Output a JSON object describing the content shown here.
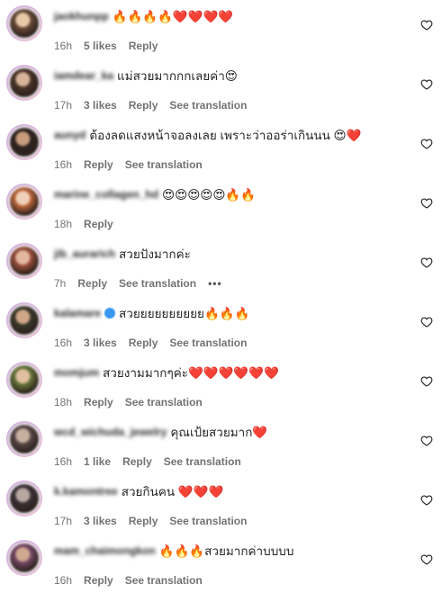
{
  "comments": [
    {
      "username": "jaokhunpp",
      "text": "🔥🔥🔥🔥❤️❤️❤️❤️",
      "time": "16h",
      "likes": "5 likes",
      "reply": "Reply",
      "see_translation": "",
      "verified": false
    },
    {
      "username": "iamdear_ka",
      "text": "แม่สวยมากกกเลยค่า😍",
      "time": "17h",
      "likes": "3 likes",
      "reply": "Reply",
      "see_translation": "See translation",
      "verified": false
    },
    {
      "username": "aunyd",
      "text": "ต้องลดแสงหน้าจอลงเลย เพราะว่าออร่าเกินนน 😍❤️",
      "time": "16h",
      "likes": "",
      "reply": "Reply",
      "see_translation": "See translation",
      "verified": false
    },
    {
      "username": "marine_collagen_hd",
      "text": "😍😍😍😍😍🔥🔥",
      "time": "18h",
      "likes": "",
      "reply": "Reply",
      "see_translation": "",
      "verified": false
    },
    {
      "username": "jib_aurarich",
      "text": "สวยปังมากค่ะ",
      "time": "7h",
      "likes": "",
      "reply": "Reply",
      "see_translation": "See translation",
      "more": "•••",
      "verified": false
    },
    {
      "username": "kalamare",
      "text": "สวยยยยยยยยยย🔥🔥🔥",
      "time": "16h",
      "likes": "3 likes",
      "reply": "Reply",
      "see_translation": "See translation",
      "verified": true
    },
    {
      "username": "momjum",
      "text": "สวยงามมากๆค่ะ❤️❤️❤️❤️❤️❤️",
      "time": "18h",
      "likes": "",
      "reply": "Reply",
      "see_translation": "See translation",
      "verified": false
    },
    {
      "username": "wcd_wichuda_jewelry",
      "text": "คุณเป้ยสวยมาก❤️",
      "time": "16h",
      "likes": "1 like",
      "reply": "Reply",
      "see_translation": "See translation",
      "verified": false
    },
    {
      "username": "k.kamontree",
      "text": "สวยกินคน ❤️❤️❤️",
      "time": "17h",
      "likes": "3 likes",
      "reply": "Reply",
      "see_translation": "See translation",
      "verified": false
    },
    {
      "username": "mam_chaimongkon",
      "text": "🔥🔥🔥สวยมากค่าบบบบ",
      "time": "16h",
      "likes": "",
      "reply": "Reply",
      "see_translation": "See translation",
      "verified": false
    }
  ],
  "colors": {
    "username": "#262626",
    "meta": "#737373",
    "verified": "#3897f0"
  },
  "icons": {
    "like": "heart-outline-icon",
    "more": "more-dots-icon",
    "verified": "verified-badge-icon"
  }
}
